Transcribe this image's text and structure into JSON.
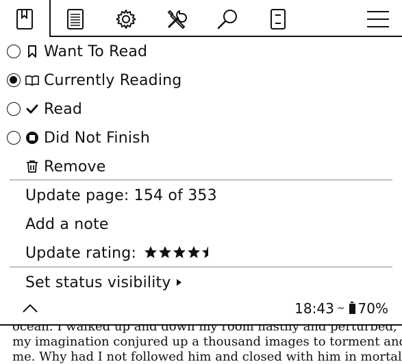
{
  "toolbar": {
    "tabs": [
      {
        "name": "bookmark-book-icon",
        "active": true
      },
      {
        "name": "toc-list-icon"
      },
      {
        "name": "settings-gear-icon"
      },
      {
        "name": "tools-icon"
      },
      {
        "name": "search-icon"
      },
      {
        "name": "ereader-icon"
      },
      {
        "name": "hamburger-menu-icon"
      }
    ]
  },
  "menu": {
    "status_options": [
      {
        "label": "Want To Read",
        "icon": "bookmark-icon",
        "checked": false
      },
      {
        "label": "Currently Reading",
        "icon": "open-book-icon",
        "checked": true
      },
      {
        "label": "Read",
        "icon": "checkmark-icon",
        "checked": false
      },
      {
        "label": "Did Not Finish",
        "icon": "stop-icon",
        "checked": false
      }
    ],
    "remove_label": "Remove",
    "update_page_label": "Update page: 154 of 353",
    "add_note_label": "Add a note",
    "update_rating_label": "Update rating:",
    "rating": 4.5,
    "rating_max": 5,
    "status_visibility_label": "Set status visibility"
  },
  "statusbar": {
    "time": "18:43",
    "frontlight_symbol": "~",
    "battery": "70%"
  },
  "book_text": {
    "lines": [
      "ocean. I walked up and down my room hastily and perturbed, while",
      "my imagination conjured up a thousand images to torment and sting",
      "me. Why had I not followed him and closed with him in mortal strife?"
    ]
  }
}
